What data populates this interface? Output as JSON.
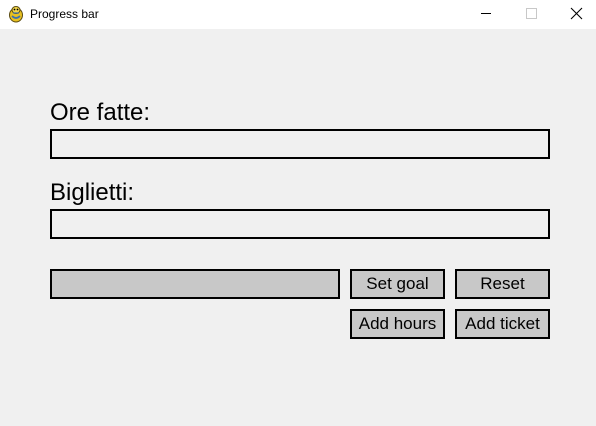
{
  "window": {
    "title": "Progress bar",
    "icon": "pygame-snake-icon",
    "controls": [
      "minimize-icon",
      "maximize-icon",
      "close-icon"
    ]
  },
  "main": {
    "hours_label": "Ore fatte:",
    "hours_progress": 0,
    "tickets_label": "Biglietti:",
    "tickets_progress": 0,
    "goal_input": {
      "value": "",
      "placeholder": ""
    },
    "buttons": {
      "set_goal": "Set goal",
      "reset": "Reset",
      "add_hours": "Add hours",
      "add_ticket": "Add ticket"
    }
  },
  "colors": {
    "background": "#f0f0f0",
    "titlebar": "#ffffff",
    "button_fill": "#c8c8c8",
    "border": "#000000"
  }
}
